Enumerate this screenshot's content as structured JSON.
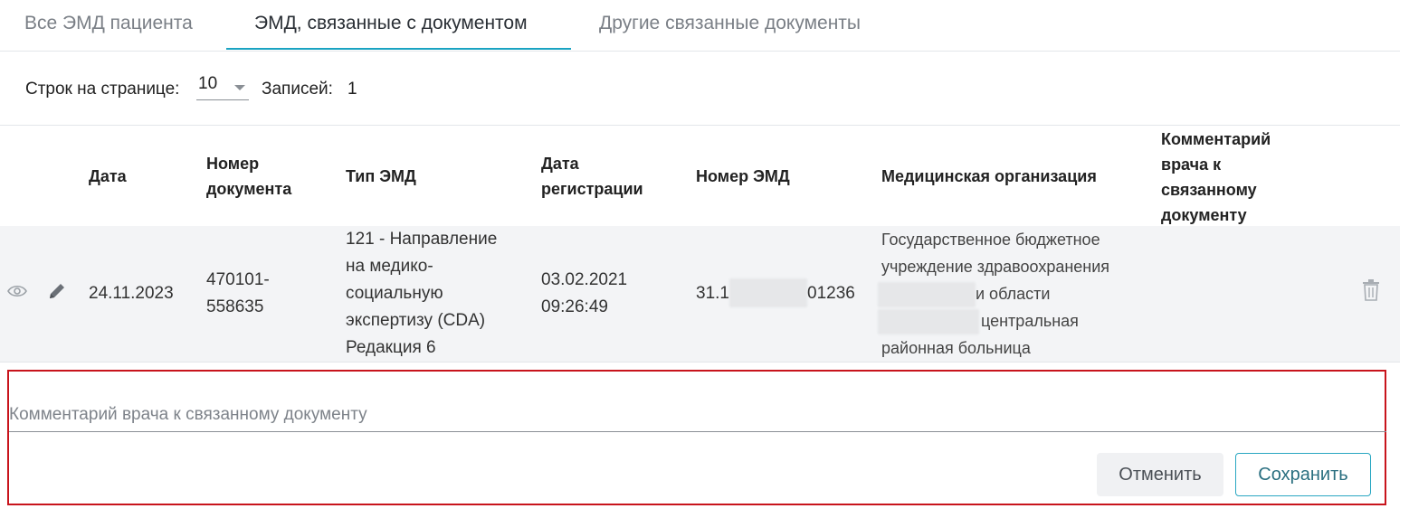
{
  "tabs": [
    {
      "label": "Все ЭМД пациента"
    },
    {
      "label": "ЭМД, связанные с документом"
    },
    {
      "label": "Другие связанные документы"
    }
  ],
  "pager": {
    "rows_label": "Строк на странице:",
    "rows_value": "10",
    "records_label": "Записей:",
    "records_value": "1"
  },
  "table": {
    "headers": {
      "date": "Дата",
      "doc_number_1": "Номер",
      "doc_number_2": "документа",
      "emd_type": "Тип ЭМД",
      "reg_date_1": "Дата",
      "reg_date_2": "регистрации",
      "emd_number": "Номер ЭМД",
      "org": "Медицинская организация",
      "comment_1": "Комментарий",
      "comment_2": "врача к",
      "comment_3": "связанному",
      "comment_4": "документу"
    },
    "row": {
      "date": "24.11.2023",
      "doc_number_1": "470101-",
      "doc_number_2": "558635",
      "emd_type_1": "121 - Направление",
      "emd_type_2": "на медико-",
      "emd_type_3": "социальную",
      "emd_type_4": "экспертизу (CDA)",
      "emd_type_5": "Редакция 6",
      "reg_date_1": "03.02.2021",
      "reg_date_2": "09:26:49",
      "emd_number_start": "31.1",
      "emd_number_end": "01236",
      "org_1": "Государственное бюджетное",
      "org_2": "учреждение здравоохранения",
      "org_3": "и области",
      "org_4": "центральная",
      "org_5": "районная больница"
    }
  },
  "comment": {
    "placeholder": "Комментарий врача к связанному документу",
    "cancel_label": "Отменить",
    "save_label": "Сохранить"
  },
  "colors": {
    "accent": "#1aa3c2",
    "highlight_border": "#c8141c"
  }
}
